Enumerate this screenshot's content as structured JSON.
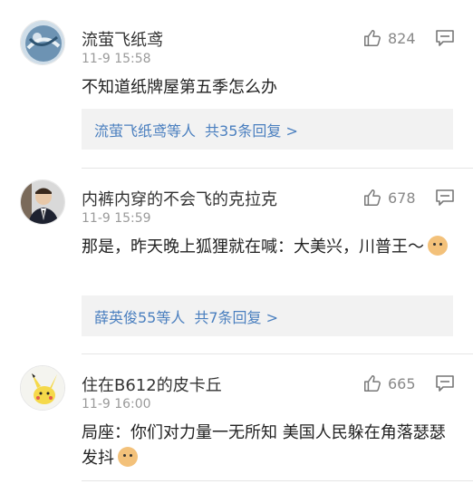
{
  "comments": [
    {
      "username": "流萤飞纸鸢",
      "timestamp": "11-9 15:58",
      "text": "不知道纸牌屋第五季怎么办",
      "likes": "824",
      "reply_summary": {
        "names": "流萤飞纸鸢等人",
        "count": "共35条回复 >"
      },
      "avatar_icon": "globe-painting-avatar"
    },
    {
      "username": "内裤内穿的不会飞的克拉克",
      "timestamp": "11-9 15:59",
      "text": "那是，昨天晚上狐狸就在喊：大美兴，川普王～",
      "likes": "678",
      "reply_summary": {
        "names": "薛英俊55等人",
        "count": "共7条回复 >"
      },
      "avatar_icon": "man-in-suit-avatar",
      "emoji_icon": "doge-emoji"
    },
    {
      "username": "住在B612的皮卡丘",
      "timestamp": "11-9 16:00",
      "text": "局座：你们对力量一无所知 美国人民躲在角落瑟瑟发抖",
      "likes": "665",
      "avatar_icon": "pikachu-avatar",
      "emoji_icon": "doge-emoji"
    }
  ],
  "colors": {
    "link_blue": "#4a7fbf",
    "meta_gray": "#9a9a9a",
    "reply_bg": "#f2f2f2"
  }
}
